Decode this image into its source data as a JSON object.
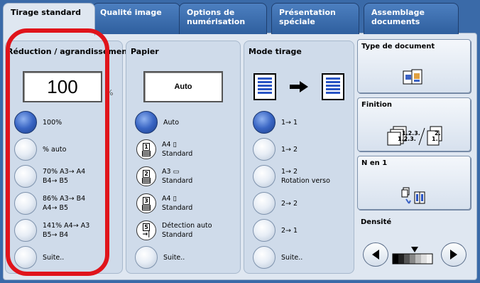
{
  "tabs": [
    {
      "label": "Tirage standard"
    },
    {
      "label": "Qualité image"
    },
    {
      "label": "Options de\nnumérisation"
    },
    {
      "label": "Présentation\nspéciale"
    },
    {
      "label": "Assemblage\ndocuments"
    }
  ],
  "reduction": {
    "title": "Réduction / agrandissement",
    "value": "100",
    "unit": "%",
    "options": [
      {
        "label": "100%",
        "selected": true
      },
      {
        "label": "% auto"
      },
      {
        "label": "70% A3→ A4\nB4→ B5"
      },
      {
        "label": "86% A3→ B4\nA4→ B5"
      },
      {
        "label": "141% A4→ A3\nB5→ B4"
      },
      {
        "label": "Suite.."
      }
    ]
  },
  "paper": {
    "title": "Papier",
    "value": "Auto",
    "options": [
      {
        "label": "Auto",
        "selected": true
      },
      {
        "label": "A4 ▯\nStandard",
        "tray": "1"
      },
      {
        "label": "A3 ▭\nStandard",
        "tray": "2"
      },
      {
        "label": "A4 ▯\nStandard",
        "tray": "3"
      },
      {
        "label": "Détection auto\nStandard",
        "tray": "5"
      },
      {
        "label": "Suite.."
      }
    ]
  },
  "mode": {
    "title": "Mode tirage",
    "options": [
      {
        "label": "1→ 1",
        "selected": true
      },
      {
        "label": "1→ 2"
      },
      {
        "label": "1→ 2\nRotation verso"
      },
      {
        "label": "2→ 2"
      },
      {
        "label": "2→ 1"
      },
      {
        "label": "Suite.."
      }
    ]
  },
  "side": {
    "doc_type": "Type de document",
    "finishing": "Finition",
    "n_up": "N en 1",
    "density": "Densité"
  },
  "colors": {
    "accent": "#3a6aa8",
    "selected_radio": "#3a66c4",
    "annotation": "#e0141b"
  }
}
